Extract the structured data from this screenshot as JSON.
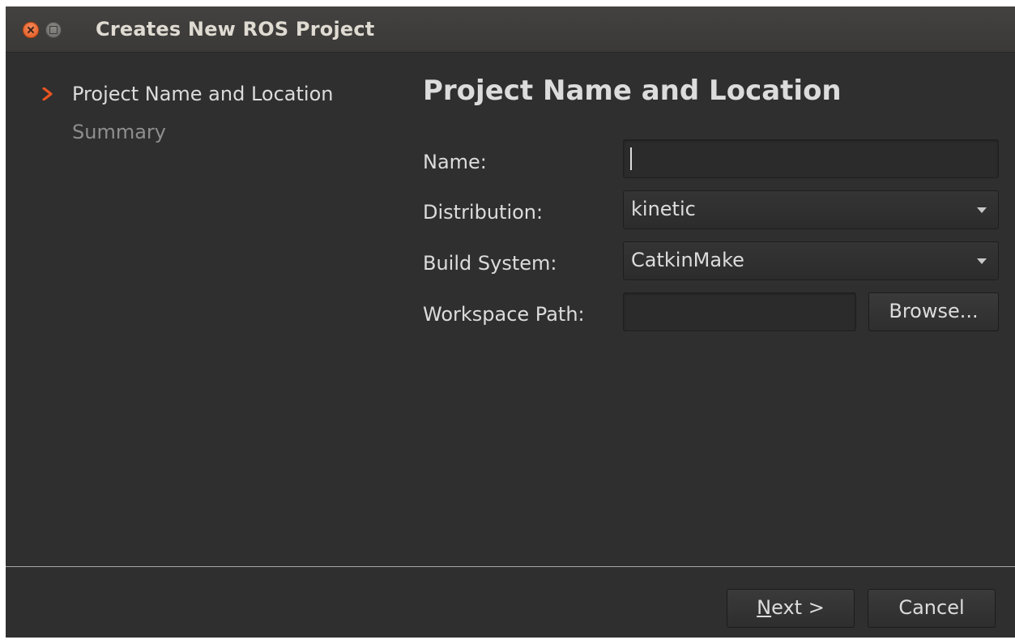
{
  "window": {
    "title": "Creates New ROS Project",
    "controls": [
      "close-icon",
      "maximize-icon"
    ]
  },
  "steps": [
    {
      "label": "Project Name and Location",
      "state": "active"
    },
    {
      "label": "Summary",
      "state": "inactive"
    }
  ],
  "page": {
    "title": "Project Name and Location"
  },
  "form": {
    "name_label": "Name:",
    "name_value": "",
    "distribution_label": "Distribution:",
    "distribution_value": "kinetic",
    "build_system_label": "Build System:",
    "build_system_value": "CatkinMake",
    "workspace_label": "Workspace Path:",
    "workspace_value": "",
    "browse_label": "Browse..."
  },
  "footer": {
    "next_mnemonic": "N",
    "next_rest": "ext >",
    "cancel_label": "Cancel"
  },
  "colors": {
    "background": "#2f2f2f",
    "titlebar": "#3c3b37",
    "accent": "#e95420",
    "text": "#dcdcdc",
    "text_muted": "#8e8e8e"
  }
}
